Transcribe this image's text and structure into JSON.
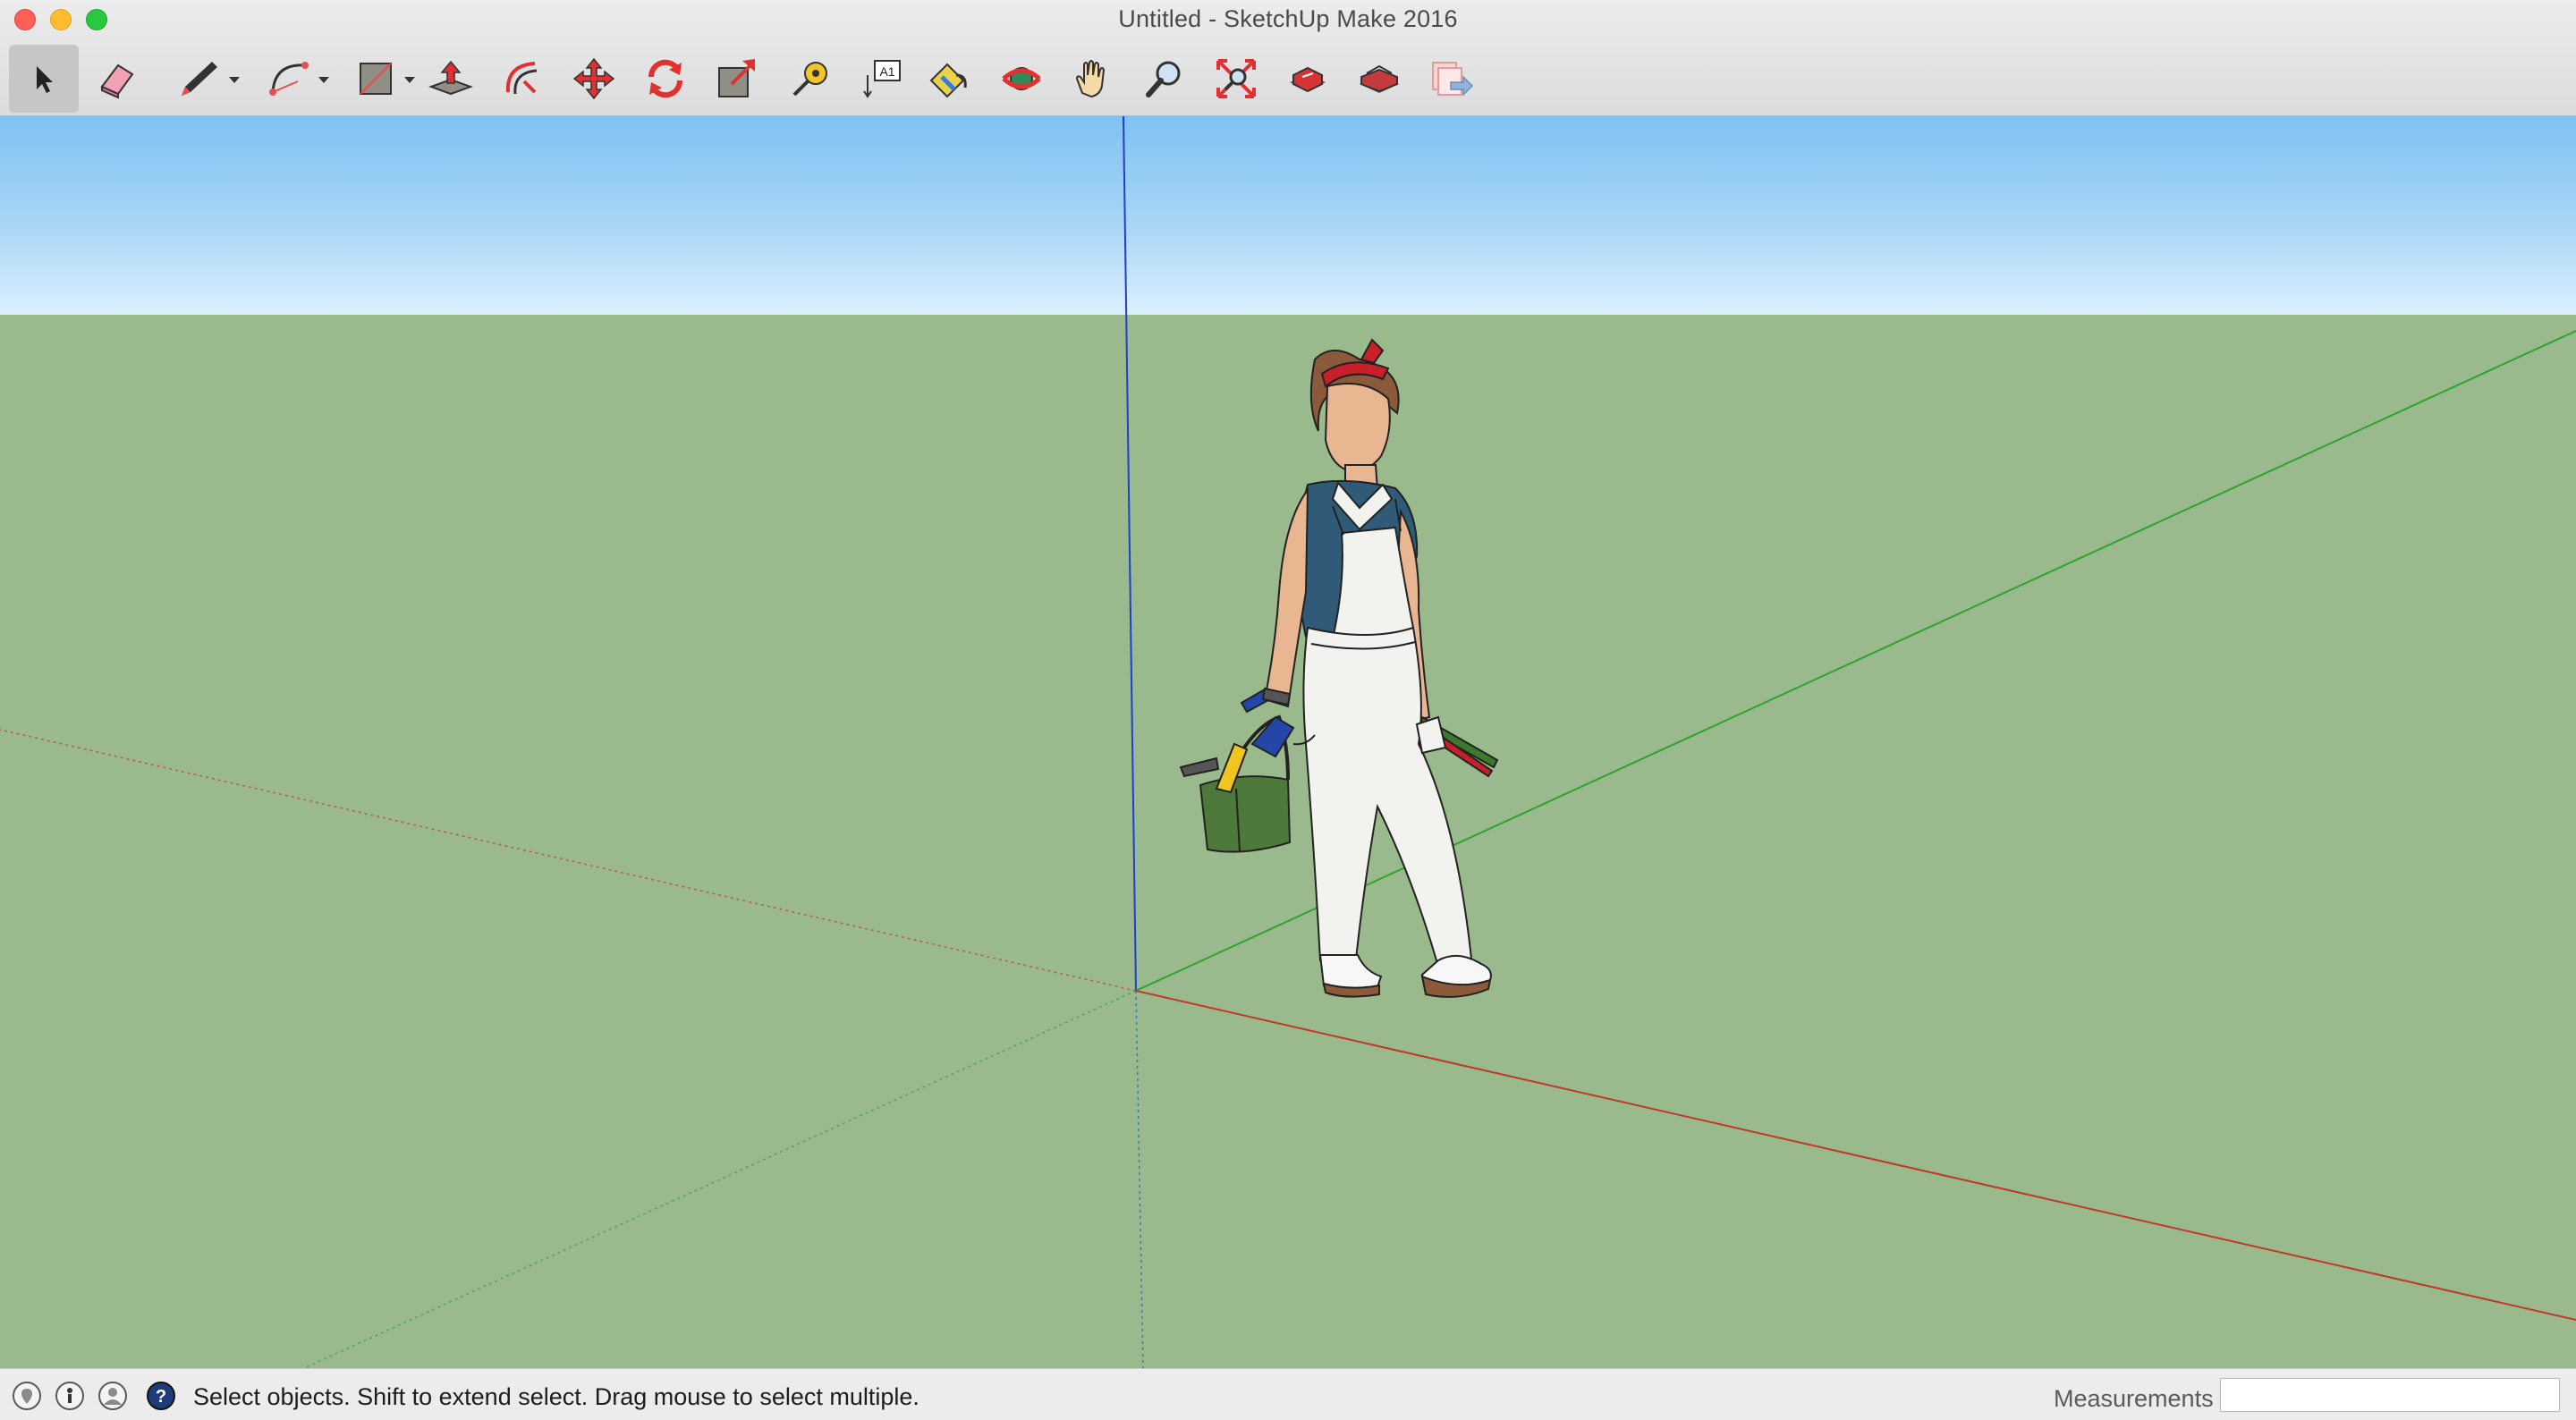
{
  "window": {
    "title": "Untitled - SketchUp Make 2016"
  },
  "toolbar": {
    "tools": [
      {
        "id": "select",
        "icon": "select-arrow-icon",
        "active": true
      },
      {
        "id": "eraser",
        "icon": "eraser-icon"
      },
      {
        "id": "pencil",
        "icon": "pencil-line-icon",
        "dropdown": true
      },
      {
        "id": "arc",
        "icon": "arc-icon",
        "dropdown": true
      },
      {
        "id": "rectangle",
        "icon": "rectangle-icon",
        "dropdown": true
      },
      {
        "id": "push-pull",
        "icon": "push-pull-icon"
      },
      {
        "id": "offset",
        "icon": "offset-icon"
      },
      {
        "id": "move",
        "icon": "move-icon"
      },
      {
        "id": "rotate",
        "icon": "rotate-icon"
      },
      {
        "id": "scale",
        "icon": "scale-icon"
      },
      {
        "id": "tape-measure",
        "icon": "tape-measure-icon"
      },
      {
        "id": "text",
        "icon": "text-icon",
        "text": "A1"
      },
      {
        "id": "paint-bucket",
        "icon": "paint-bucket-icon"
      },
      {
        "id": "orbit",
        "icon": "orbit-icon"
      },
      {
        "id": "pan",
        "icon": "pan-hand-icon"
      },
      {
        "id": "zoom",
        "icon": "zoom-icon"
      },
      {
        "id": "zoom-extents",
        "icon": "zoom-extents-icon"
      },
      {
        "id": "3d-warehouse",
        "icon": "warehouse-icon"
      },
      {
        "id": "extension-warehouse",
        "icon": "extension-warehouse-icon"
      },
      {
        "id": "send-to-layout",
        "icon": "send-to-layout-icon"
      }
    ]
  },
  "viewport": {
    "sky_color": "#8ec9f4",
    "ground_color": "#9aba8d",
    "axes": {
      "red": "#c0392b",
      "green": "#2ea32e",
      "blue": "#1f3fd0"
    },
    "model": "scale-figure-woman-with-toolbox"
  },
  "statusbar": {
    "icons": [
      "geolocation-icon",
      "credits-icon",
      "account-icon",
      "instructor-help-icon"
    ],
    "message": "Select objects. Shift to extend select. Drag mouse to select multiple.",
    "measurements_label": "Measurements",
    "measurements_value": ""
  }
}
